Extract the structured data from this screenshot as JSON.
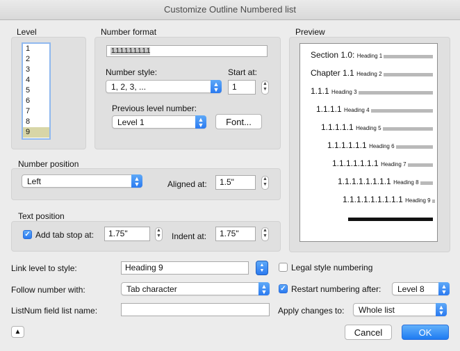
{
  "window": {
    "title": "Customize Outline Numbered list"
  },
  "level": {
    "label": "Level",
    "items": [
      "1",
      "2",
      "3",
      "4",
      "5",
      "6",
      "7",
      "8",
      "9"
    ],
    "selected": "9"
  },
  "number_format": {
    "label": "Number format",
    "format_value": "1.1.1.1.1.1.1.1.1",
    "number_style_label": "Number style:",
    "number_style_value": "1, 2, 3, ...",
    "start_at_label": "Start at:",
    "start_at_value": "1",
    "previous_level_label": "Previous level number:",
    "previous_level_value": "Level 1",
    "font_button": "Font..."
  },
  "number_position": {
    "label": "Number position",
    "alignment_value": "Left",
    "aligned_at_label": "Aligned at:",
    "aligned_at_value": "1.5\""
  },
  "text_position": {
    "label": "Text position",
    "add_tab_stop_label": "Add tab stop at:",
    "add_tab_stop_checked": true,
    "tab_stop_value": "1.75\"",
    "indent_at_label": "Indent at:",
    "indent_at_value": "1.75\""
  },
  "preview": {
    "label": "Preview",
    "rows": [
      {
        "num": "Section 1.0:",
        "style": "Heading 1"
      },
      {
        "num": "Chapter 1.1",
        "style": "Heading 2"
      },
      {
        "num": "1.1.1",
        "style": "Heading 3"
      },
      {
        "num": "1.1.1.1",
        "style": "Heading 4"
      },
      {
        "num": "1.1.1.1.1",
        "style": "Heading 5"
      },
      {
        "num": "1.1.1.1.1.1",
        "style": "Heading 6"
      },
      {
        "num": "1.1.1.1.1.1.1",
        "style": "Heading 7"
      },
      {
        "num": "1.1.1.1.1.1.1.1",
        "style": "Heading 8"
      },
      {
        "num": "1.1.1.1.1.1.1.1.1",
        "style": "Heading 9"
      }
    ]
  },
  "link_level": {
    "label": "Link level to style:",
    "value": "Heading 9"
  },
  "follow_number": {
    "label": "Follow number with:",
    "value": "Tab character"
  },
  "listnum": {
    "label": "ListNum field list name:",
    "value": ""
  },
  "legal_style": {
    "label": "Legal style numbering",
    "checked": false
  },
  "restart_numbering": {
    "label": "Restart numbering after:",
    "checked": true,
    "value": "Level 8"
  },
  "apply_changes": {
    "label": "Apply changes to:",
    "value": "Whole list"
  },
  "buttons": {
    "cancel": "Cancel",
    "ok": "OK"
  },
  "colors": {
    "accent": "#2b7af0",
    "selection": "#d8d6a7"
  }
}
